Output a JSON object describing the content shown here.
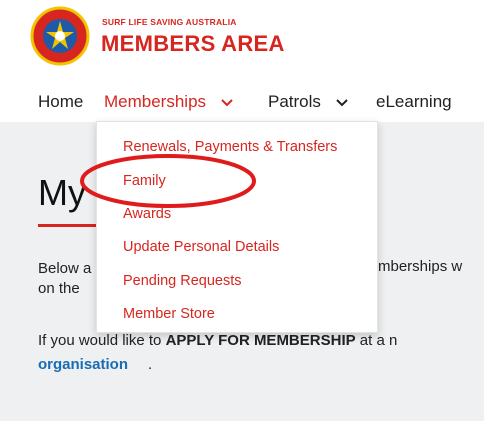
{
  "header": {
    "brand_top": "SURF LIFE SAVING AUSTRALIA",
    "brand_main": "MEMBERS AREA",
    "logo_text_top": "SURF",
    "logo_text_bottom": "LIFE SAVING"
  },
  "nav": {
    "items": [
      {
        "label": "Home"
      },
      {
        "label": "Memberships",
        "icon": "chevron-down-icon"
      },
      {
        "label": "Patrols",
        "icon": "chevron-down-icon"
      },
      {
        "label": "eLearning"
      }
    ]
  },
  "dropdown": {
    "items": [
      {
        "label": "Renewals, Payments & Transfers"
      },
      {
        "label": "Family"
      },
      {
        "label": "Awards"
      },
      {
        "label": "Update Personal Details"
      },
      {
        "label": "Pending Requests"
      },
      {
        "label": "Member Store"
      }
    ],
    "highlight_color": "#d7261f"
  },
  "main": {
    "title": "My",
    "para1_line1": "Below a",
    "para1_right": "mberships w",
    "para1_line2": "on the",
    "para2_prefix": "If you would like to ",
    "para2_bold": "APPLY FOR MEMBERSHIP",
    "para2_suffix": " at a n",
    "para2_link": "organisation",
    "para2_end": "."
  },
  "colors": {
    "brand": "#d7261f",
    "link": "#1a6db3",
    "content_bg": "#eef0f2"
  }
}
